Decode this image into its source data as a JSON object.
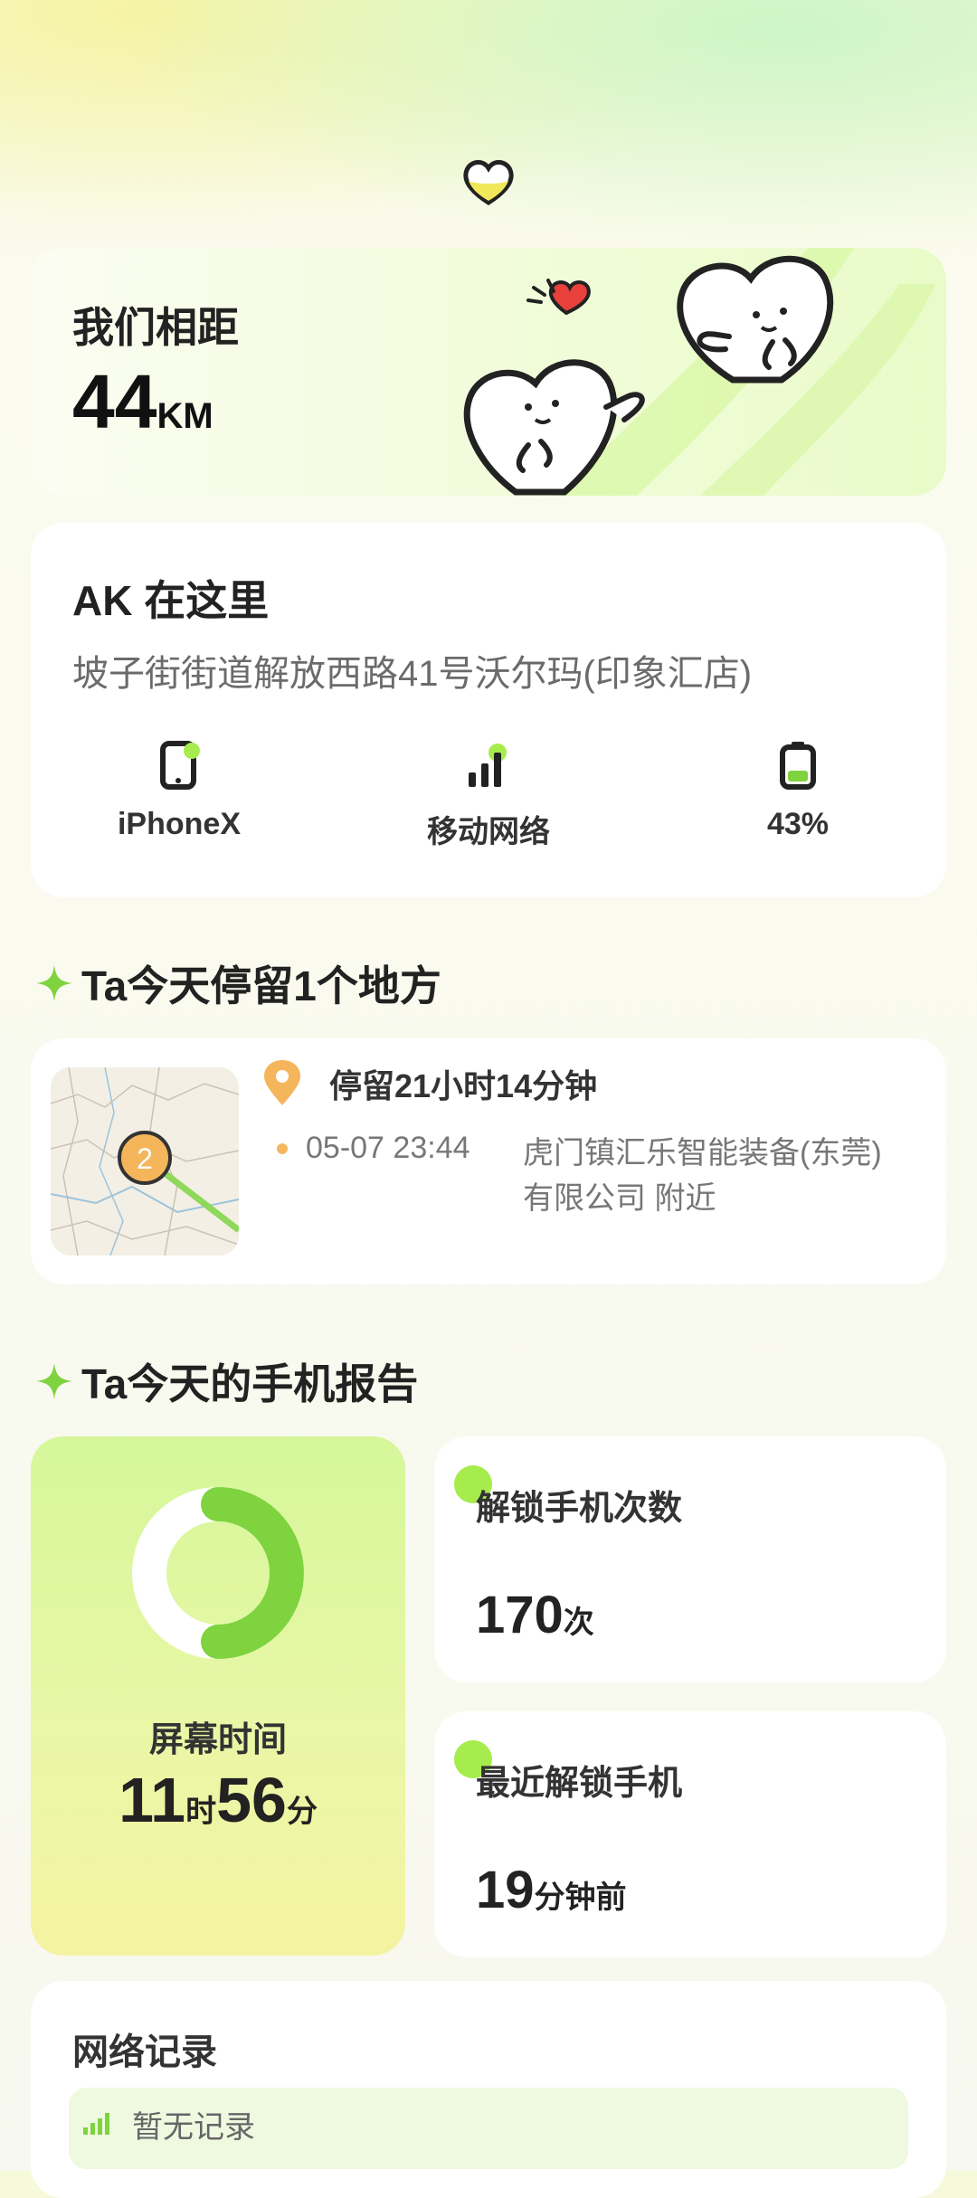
{
  "distance": {
    "title": "我们相距",
    "value": "44",
    "unit": "KM"
  },
  "location": {
    "title": "AK 在这里",
    "address": "坡子街街道解放西路41号沃尔玛(印象汇店)",
    "device": {
      "label": "iPhoneX",
      "icon": "phone-icon"
    },
    "network": {
      "label": "移动网络",
      "icon": "signal-icon"
    },
    "battery": {
      "label": "43%",
      "level": 0.43,
      "icon": "battery-icon"
    }
  },
  "stays": {
    "title": "Ta今天停留1个地方",
    "marker_number": "2",
    "duration": "停留21小时14分钟",
    "time": "05-07 23:44",
    "place": "虎门镇汇乐智能装备(东莞)有限公司 附近"
  },
  "report": {
    "title": "Ta今天的手机报告",
    "screen_time": {
      "label": "屏幕时间",
      "hours": "11",
      "hours_unit": "时",
      "minutes": "56",
      "minutes_unit": "分",
      "ring_fraction": 0.5
    },
    "unlock_count": {
      "title": "解锁手机次数",
      "value": "170",
      "unit": "次"
    },
    "last_unlock": {
      "title": "最近解锁手机",
      "value": "19",
      "unit": "分钟前"
    }
  },
  "network_log": {
    "title": "网络记录",
    "empty_text": "暂无记录"
  },
  "colors": {
    "accent_green": "#7ed33f",
    "light_green": "#a6ec4c",
    "orange": "#f5b55b"
  }
}
